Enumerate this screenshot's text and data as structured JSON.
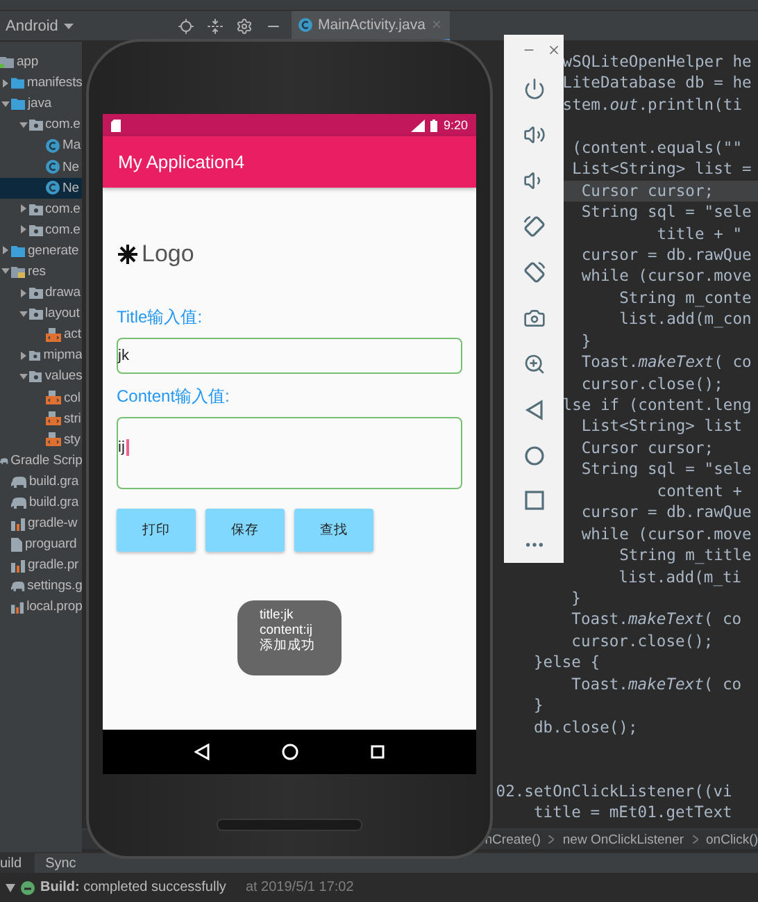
{
  "project_view": {
    "selector": "Android",
    "items": [
      {
        "label": "app",
        "kind": "module",
        "selected": false,
        "children": [
          {
            "label": "manifests",
            "kind": "folder",
            "expanded": false,
            "selected": false
          },
          {
            "label": "java",
            "kind": "folder",
            "expanded": true,
            "selected": false,
            "children": [
              {
                "label": "com.e",
                "kind": "package",
                "expanded": true,
                "selected": false,
                "children": [
                  {
                    "label": "Ma",
                    "kind": "class",
                    "selected": false
                  },
                  {
                    "label": "Ne",
                    "kind": "class",
                    "selected": false
                  },
                  {
                    "label": "Ne",
                    "kind": "class",
                    "selected": true
                  }
                ]
              },
              {
                "label": "com.e",
                "kind": "package",
                "expanded": false,
                "selected": false
              },
              {
                "label": "com.e",
                "kind": "package",
                "expanded": false,
                "selected": false
              }
            ]
          },
          {
            "label": "generate",
            "kind": "generated",
            "expanded": false,
            "selected": false
          },
          {
            "label": "res",
            "kind": "resources",
            "expanded": true,
            "selected": false,
            "children": [
              {
                "label": "drawa",
                "kind": "package",
                "expanded": false,
                "selected": false
              },
              {
                "label": "layout",
                "kind": "package",
                "expanded": true,
                "selected": false,
                "children": [
                  {
                    "label": "act",
                    "kind": "xml",
                    "selected": false
                  }
                ]
              },
              {
                "label": "mipma",
                "kind": "package",
                "expanded": false,
                "selected": false
              },
              {
                "label": "values",
                "kind": "package",
                "expanded": true,
                "selected": false,
                "children": [
                  {
                    "label": "col",
                    "kind": "xml",
                    "selected": false
                  },
                  {
                    "label": "stri",
                    "kind": "xml",
                    "selected": false
                  },
                  {
                    "label": "sty",
                    "kind": "xml",
                    "selected": false
                  }
                ]
              }
            ]
          }
        ]
      },
      {
        "label": "Gradle Scrip",
        "kind": "gradle_root",
        "selected": false,
        "children": [
          {
            "label": "build.gra",
            "kind": "gradle",
            "selected": false
          },
          {
            "label": "build.gra",
            "kind": "gradle",
            "selected": false
          },
          {
            "label": "gradle-w",
            "kind": "properties",
            "selected": false
          },
          {
            "label": "proguard",
            "kind": "file",
            "selected": false
          },
          {
            "label": "gradle.pr",
            "kind": "properties",
            "selected": false
          },
          {
            "label": "settings.g",
            "kind": "gradle",
            "selected": false
          },
          {
            "label": "local.prop",
            "kind": "properties",
            "selected": false
          }
        ]
      }
    ]
  },
  "editor_tabs": [
    {
      "label": "MainActivity.java",
      "selected": true
    }
  ],
  "code_sections": [
    {
      "lines": [
        {
          "text": "wSQLiteOpenHelper he",
          "current": false
        },
        {
          "text": "LiteDatabase db = he",
          "current": false
        },
        {
          "text": "stem.*out*.println(ti",
          "current": false
        }
      ]
    },
    {
      "lines": [
        {
          "text": " (content.equals(\"\"",
          "current": false
        },
        {
          "text": " List<String> list =",
          "current": false
        },
        {
          "text": "  Cursor cursor;",
          "current": true
        },
        {
          "text": "  String sql = \"sele",
          "current": false
        },
        {
          "text": "          title + \"",
          "current": false
        },
        {
          "text": "  cursor = db.rawQue",
          "current": false
        },
        {
          "text": "  while (cursor.move",
          "current": false
        },
        {
          "text": "      String m_conte",
          "current": false
        },
        {
          "text": "      list.add(m_con",
          "current": false
        },
        {
          "text": "  }",
          "current": false
        },
        {
          "text": "  Toast.*makeText*( co",
          "current": false
        },
        {
          "text": "  cursor.close();",
          "current": false
        },
        {
          "text": "lse if (content.leng",
          "current": false
        },
        {
          "text": "  List<String> list",
          "current": false
        },
        {
          "text": "  Cursor cursor;",
          "current": false
        },
        {
          "text": "  String sql = \"sele",
          "current": false
        },
        {
          "text": "          content +",
          "current": false
        },
        {
          "text": "  cursor = db.rawQue",
          "current": false
        },
        {
          "text": "  while (cursor.move",
          "current": false
        },
        {
          "text": "      String m_title",
          "current": false
        }
      ]
    },
    {
      "lines": [
        {
          "text": "             list.add(m_ti",
          "current": false
        },
        {
          "text": "        }",
          "current": false
        },
        {
          "text": "        Toast.*makeText*( co",
          "current": false
        },
        {
          "text": "        cursor.close();",
          "current": false
        },
        {
          "text": "    }else {",
          "current": false
        },
        {
          "text": "        Toast.*makeText*( co",
          "current": false
        },
        {
          "text": "    }",
          "current": false
        },
        {
          "text": "    db.close();",
          "current": false
        }
      ]
    },
    {
      "lines": [
        {
          "text": "02.setOnClickListener((vi",
          "current": false
        },
        {
          "text": "    title = mEt01.getText",
          "current": false
        }
      ]
    }
  ],
  "breadcrumb": [
    "nCreate()",
    "new OnClickListener",
    "onClick()"
  ],
  "emulator": {
    "status_time": "9:20",
    "app_title": "My Application4",
    "logo_text": "Logo",
    "title_label": "Title输入值:",
    "title_value": "jk",
    "content_label": "Content输入值:",
    "content_value": "ij",
    "buttons": [
      "打印",
      "保存",
      "查找"
    ],
    "toast": [
      "title:jk",
      "content:ij",
      "添加成功"
    ]
  },
  "bottom_tabs": [
    {
      "label": "uild",
      "selected": true
    },
    {
      "label": "Sync",
      "selected": false
    }
  ],
  "build_log": {
    "title": "Build:",
    "message": "completed successfully",
    "time": "at 2019/5/1 17:02"
  }
}
